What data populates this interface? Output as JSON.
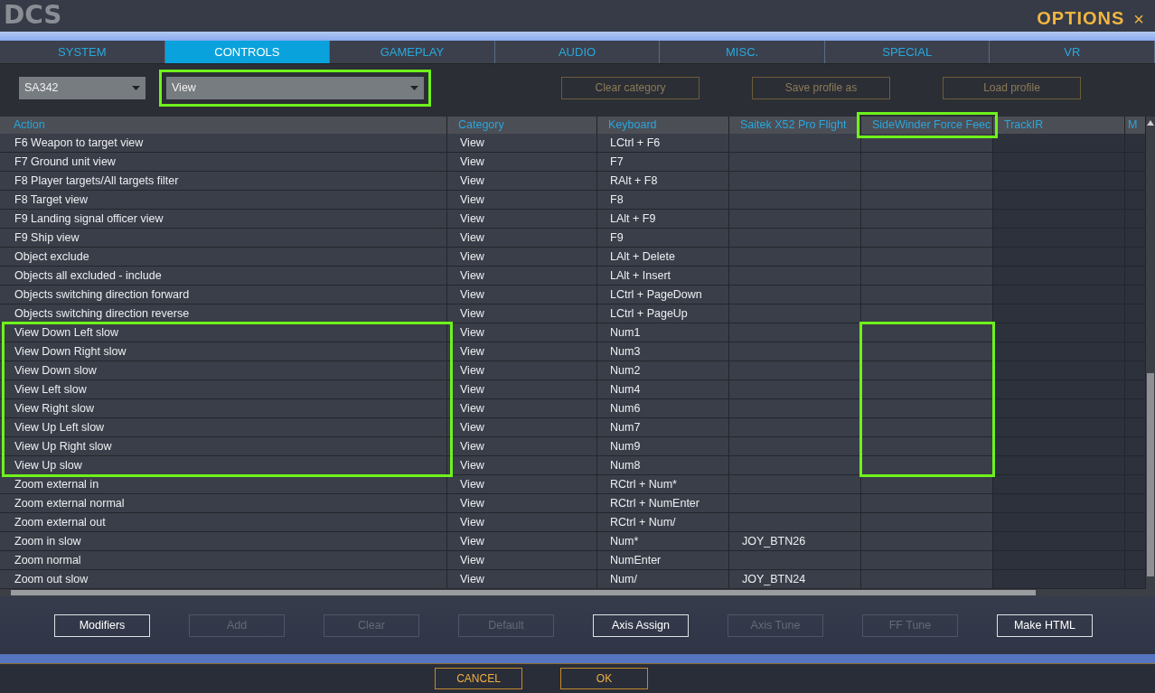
{
  "window": {
    "logo": "DCS",
    "title": "OPTIONS",
    "close": "×"
  },
  "tabs": [
    {
      "label": "SYSTEM",
      "selected": false
    },
    {
      "label": "CONTROLS",
      "selected": true
    },
    {
      "label": "GAMEPLAY",
      "selected": false
    },
    {
      "label": "AUDIO",
      "selected": false
    },
    {
      "label": "MISC.",
      "selected": false
    },
    {
      "label": "SPECIAL",
      "selected": false
    },
    {
      "label": "VR",
      "selected": false
    }
  ],
  "toolbar": {
    "aircraft": {
      "value": "SA342"
    },
    "category": {
      "value": "View",
      "highlighted": true
    },
    "buttons": [
      {
        "label": "Clear category",
        "disabled": true
      },
      {
        "label": "Save profile as",
        "disabled": true
      },
      {
        "label": "Load profile",
        "disabled": true
      }
    ]
  },
  "table": {
    "columns": [
      {
        "label": "Action",
        "highlighted": false
      },
      {
        "label": "Category",
        "highlighted": false
      },
      {
        "label": "Keyboard",
        "highlighted": false
      },
      {
        "label": "Saitek X52 Pro Flight",
        "highlighted": false
      },
      {
        "label": "SideWinder Force Feec",
        "highlighted": true
      },
      {
        "label": "TrackIR",
        "highlighted": false
      },
      {
        "label": "M",
        "highlighted": false
      }
    ],
    "rows": [
      {
        "action": "F6 Weapon to target view",
        "category": "View",
        "keyboard": "LCtrl + F6",
        "joystick": "",
        "highlighted": false
      },
      {
        "action": "F7 Ground unit view",
        "category": "View",
        "keyboard": "F7",
        "joystick": "",
        "highlighted": false
      },
      {
        "action": "F8 Player targets/All targets filter",
        "category": "View",
        "keyboard": "RAlt + F8",
        "joystick": "",
        "highlighted": false
      },
      {
        "action": "F8 Target view",
        "category": "View",
        "keyboard": "F8",
        "joystick": "",
        "highlighted": false
      },
      {
        "action": "F9 Landing signal officer view",
        "category": "View",
        "keyboard": "LAlt + F9",
        "joystick": "",
        "highlighted": false
      },
      {
        "action": "F9 Ship view",
        "category": "View",
        "keyboard": "F9",
        "joystick": "",
        "highlighted": false
      },
      {
        "action": "Object exclude",
        "category": "View",
        "keyboard": "LAlt + Delete",
        "joystick": "",
        "highlighted": false
      },
      {
        "action": "Objects all excluded - include",
        "category": "View",
        "keyboard": "LAlt + Insert",
        "joystick": "",
        "highlighted": false
      },
      {
        "action": "Objects switching direction forward",
        "category": "View",
        "keyboard": "LCtrl + PageDown",
        "joystick": "",
        "highlighted": false
      },
      {
        "action": "Objects switching direction reverse",
        "category": "View",
        "keyboard": "LCtrl + PageUp",
        "joystick": "",
        "highlighted": false
      },
      {
        "action": "View Down Left slow",
        "category": "View",
        "keyboard": "Num1",
        "joystick": "",
        "highlighted": true
      },
      {
        "action": "View Down Right slow",
        "category": "View",
        "keyboard": "Num3",
        "joystick": "",
        "highlighted": true
      },
      {
        "action": "View Down slow",
        "category": "View",
        "keyboard": "Num2",
        "joystick": "",
        "highlighted": true
      },
      {
        "action": "View Left slow",
        "category": "View",
        "keyboard": "Num4",
        "joystick": "",
        "highlighted": true
      },
      {
        "action": "View Right slow",
        "category": "View",
        "keyboard": "Num6",
        "joystick": "",
        "highlighted": true
      },
      {
        "action": "View Up Left slow",
        "category": "View",
        "keyboard": "Num7",
        "joystick": "",
        "highlighted": true
      },
      {
        "action": "View Up Right slow",
        "category": "View",
        "keyboard": "Num9",
        "joystick": "",
        "highlighted": true
      },
      {
        "action": "View Up slow",
        "category": "View",
        "keyboard": "Num8",
        "joystick": "",
        "highlighted": true
      },
      {
        "action": "Zoom external in",
        "category": "View",
        "keyboard": "RCtrl + Num*",
        "joystick": "",
        "highlighted": false
      },
      {
        "action": "Zoom external normal",
        "category": "View",
        "keyboard": "RCtrl + NumEnter",
        "joystick": "",
        "highlighted": false
      },
      {
        "action": "Zoom external out",
        "category": "View",
        "keyboard": "RCtrl + Num/",
        "joystick": "",
        "highlighted": false
      },
      {
        "action": "Zoom in slow",
        "category": "View",
        "keyboard": "Num*",
        "joystick": "JOY_BTN26",
        "highlighted": false
      },
      {
        "action": "Zoom normal",
        "category": "View",
        "keyboard": "NumEnter",
        "joystick": "",
        "highlighted": false
      },
      {
        "action": "Zoom out slow",
        "category": "View",
        "keyboard": "Num/",
        "joystick": "JOY_BTN24",
        "highlighted": false
      }
    ]
  },
  "actions": [
    {
      "label": "Modifiers",
      "disabled": false
    },
    {
      "label": "Add",
      "disabled": true
    },
    {
      "label": "Clear",
      "disabled": true
    },
    {
      "label": "Default",
      "disabled": true
    },
    {
      "label": "Axis Assign",
      "disabled": false
    },
    {
      "label": "Axis Tune",
      "disabled": true
    },
    {
      "label": "FF Tune",
      "disabled": true
    },
    {
      "label": "Make HTML",
      "disabled": false
    }
  ],
  "footer": [
    {
      "label": "CANCEL"
    },
    {
      "label": "OK"
    }
  ]
}
